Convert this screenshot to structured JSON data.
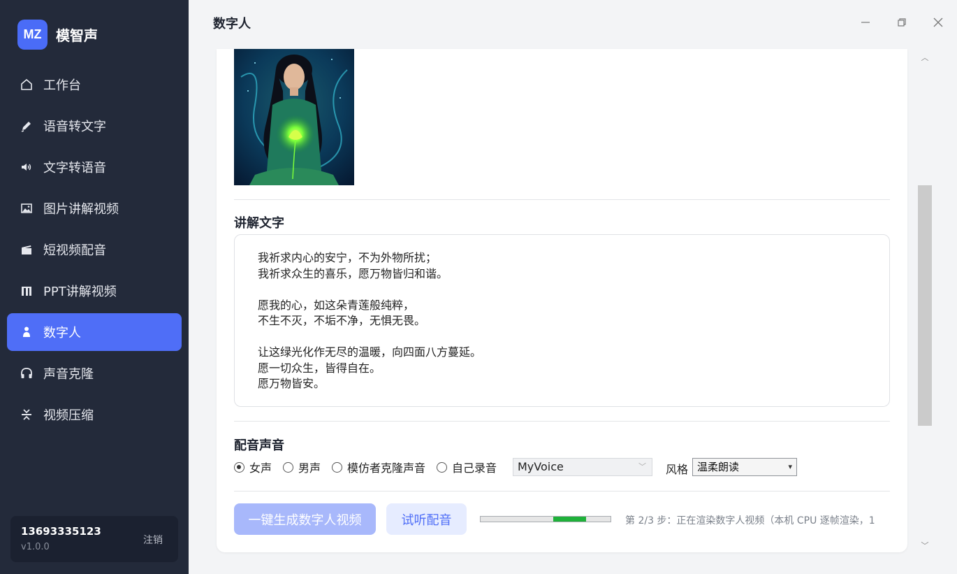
{
  "app": {
    "logo_text": "MZ",
    "name": "模智声"
  },
  "sidebar": {
    "items": [
      {
        "label": "工作台",
        "icon": "home-icon"
      },
      {
        "label": "语音转文字",
        "icon": "pencil-icon"
      },
      {
        "label": "文字转语音",
        "icon": "speaker-icon"
      },
      {
        "label": "图片讲解视频",
        "icon": "picture-icon"
      },
      {
        "label": "短视频配音",
        "icon": "clapperboard-icon"
      },
      {
        "label": "PPT讲解视频",
        "icon": "bar-chart-icon"
      },
      {
        "label": "数字人",
        "icon": "person-icon",
        "active": true
      },
      {
        "label": "声音克隆",
        "icon": "headphones-icon"
      },
      {
        "label": "视频压缩",
        "icon": "compress-icon"
      }
    ]
  },
  "user": {
    "phone": "13693335123",
    "version": "v1.0.0",
    "logout": "注销"
  },
  "header": {
    "title": "数字人"
  },
  "main": {
    "narration_title": "讲解文字",
    "narration_text": "我祈求内心的安宁，不为外物所扰；\n我祈求众生的喜乐，愿万物皆归和谐。\n\n愿我的心，如这朵青莲般纯粹，\n不生不灭，不垢不净，无惧无畏。\n\n让这绿光化作无尽的温暖，向四面八方蔓延。\n愿一切众生，皆得自在。\n愿万物皆安。",
    "voice_title": "配音声音",
    "voice_options": [
      "女声",
      "男声",
      "模仿者克隆声音",
      "自己录音"
    ],
    "voice_selected": "女声",
    "voice_select_value": "MyVoice",
    "style_label": "风格",
    "style_value": "温柔朗读",
    "generate_button": "一键生成数字人视频",
    "preview_button": "试听配音",
    "progress_fraction": 0.56,
    "progress_start_fraction": 0.56,
    "progress_fill_fraction": 0.25,
    "status_text": "第 2/3 步：正在渲染数字人视频（本机 CPU 逐帧渲染，1"
  },
  "colors": {
    "sidebar_bg": "#232a3a",
    "accent": "#4f6ef7",
    "progress": "#1fb13a"
  }
}
